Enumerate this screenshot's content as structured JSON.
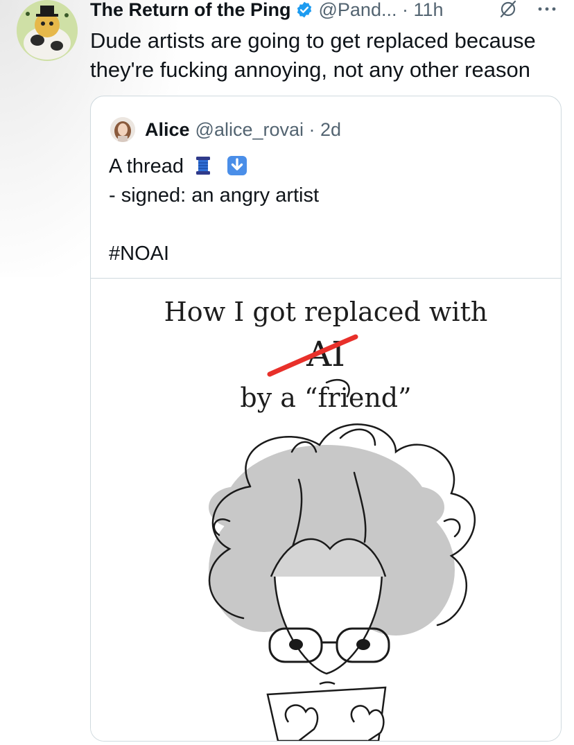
{
  "tweet": {
    "display_name": "The Return of the Ping",
    "handle_time": "@Pand... · 11h",
    "text_lines": [
      "Dude artists are going to get replaced because",
      "they're fucking annoying, not any other reason"
    ],
    "icons": [
      "verified-badge-icon",
      "grok-icon",
      "more-icon"
    ]
  },
  "quote": {
    "display_name": "Alice",
    "handle_time": "@alice_rovai · 2d",
    "line1": "A thread",
    "line2": "- signed: an angry artist",
    "hashtag": "#NOAI",
    "emojis": [
      "spool-of-thread-emoji",
      "down-arrow-emoji"
    ]
  },
  "comic": {
    "title_line1": "How I got replaced with",
    "title_line2": "AI",
    "title_line3": "by a “friend”"
  },
  "colors": {
    "text": "#0f1419",
    "secondary": "#536471",
    "verified": "#1d9bf0",
    "border": "#cfd9de",
    "strike": "#e8302a"
  }
}
